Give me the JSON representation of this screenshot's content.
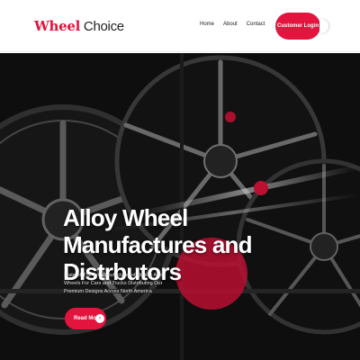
{
  "brand": {
    "word1": "Wheel",
    "word2": "Choice"
  },
  "nav": {
    "home": "Home",
    "about": "About",
    "contact": "Contact"
  },
  "login_label": "Customer Login",
  "hero": {
    "headline": "Alloy Wheel Manufactures and Distrbutors",
    "description": "State-of-The-Art Manufacturer of Quality Alloy Wheels For Cars and Trucks Distributing Our Premium Designs Across North America",
    "cta_label": "Read More",
    "cta_icon": "chevron-right-icon"
  },
  "colors": {
    "accent": "#e3143d",
    "dark": "#0f0f0f"
  }
}
